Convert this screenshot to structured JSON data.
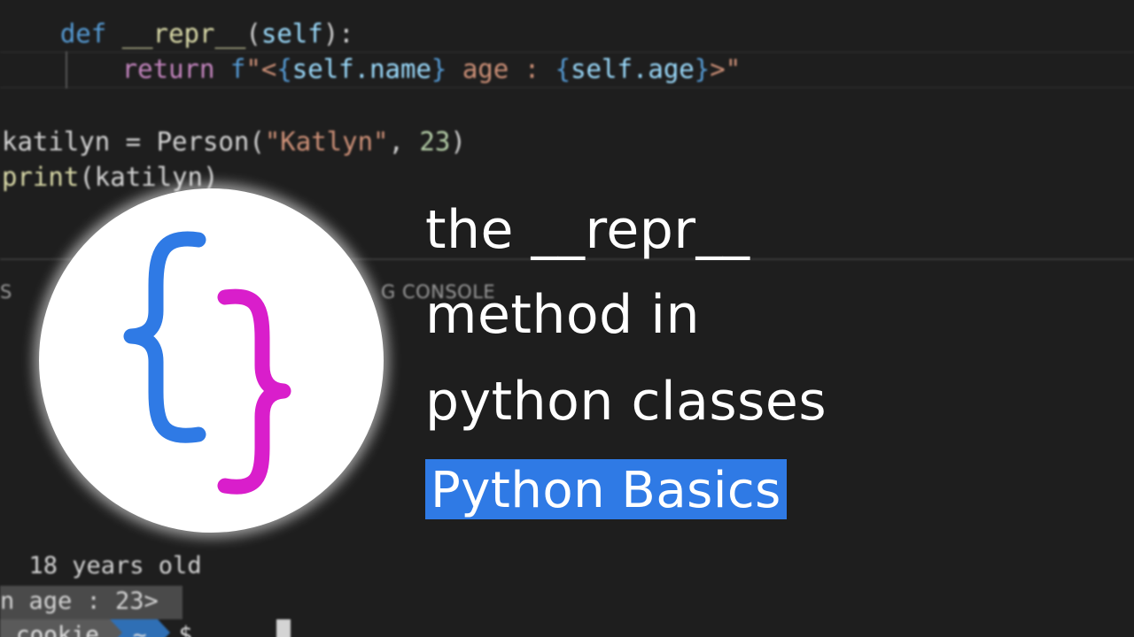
{
  "editor": {
    "code_lines": [
      {
        "indent": "    ",
        "parts": [
          {
            "cls": "kw",
            "text": "def"
          },
          {
            "cls": "plain",
            "text": " "
          },
          {
            "cls": "fn",
            "text": "__repr__"
          },
          {
            "cls": "plain",
            "text": "("
          },
          {
            "cls": "ident",
            "text": "self"
          },
          {
            "cls": "plain",
            "text": "):"
          }
        ]
      },
      {
        "indent": "        ",
        "parts": [
          {
            "cls": "ctl",
            "text": "return"
          },
          {
            "cls": "plain",
            "text": " "
          },
          {
            "cls": "kw",
            "text": "f"
          },
          {
            "cls": "str",
            "text": "\"<"
          },
          {
            "cls": "brace",
            "text": "{"
          },
          {
            "cls": "ident",
            "text": "self.name"
          },
          {
            "cls": "brace",
            "text": "}"
          },
          {
            "cls": "str",
            "text": " age : "
          },
          {
            "cls": "brace",
            "text": "{"
          },
          {
            "cls": "ident",
            "text": "self.age"
          },
          {
            "cls": "brace",
            "text": "}"
          },
          {
            "cls": "str",
            "text": ">\""
          }
        ]
      },
      {
        "indent": "",
        "parts": [
          {
            "cls": "plain",
            "text": "katilyn = Person("
          },
          {
            "cls": "str",
            "text": "\"Katlyn\""
          },
          {
            "cls": "plain",
            "text": ", "
          },
          {
            "cls": "num",
            "text": "23"
          },
          {
            "cls": "plain",
            "text": ")"
          }
        ]
      },
      {
        "indent": "",
        "parts": [
          {
            "cls": "fn",
            "text": "print"
          },
          {
            "cls": "plain",
            "text": "(katilyn)"
          }
        ]
      }
    ]
  },
  "panel": {
    "tab_left": "S",
    "tab_debug": "G CONSOLE"
  },
  "terminal": {
    "line1": "  18 years old",
    "line2": "n age : 23>",
    "prompt_user": "cookie",
    "prompt_dir": "~",
    "prompt_symbol": "$"
  },
  "logo": {
    "left_brace_color": "#2f7ae5",
    "right_brace_color": "#d91ecb"
  },
  "title": {
    "line1": "the __repr__",
    "line2": "method in",
    "line3": "python classes",
    "badge": "Python Basics",
    "badge_color": "#2f7ae5"
  }
}
